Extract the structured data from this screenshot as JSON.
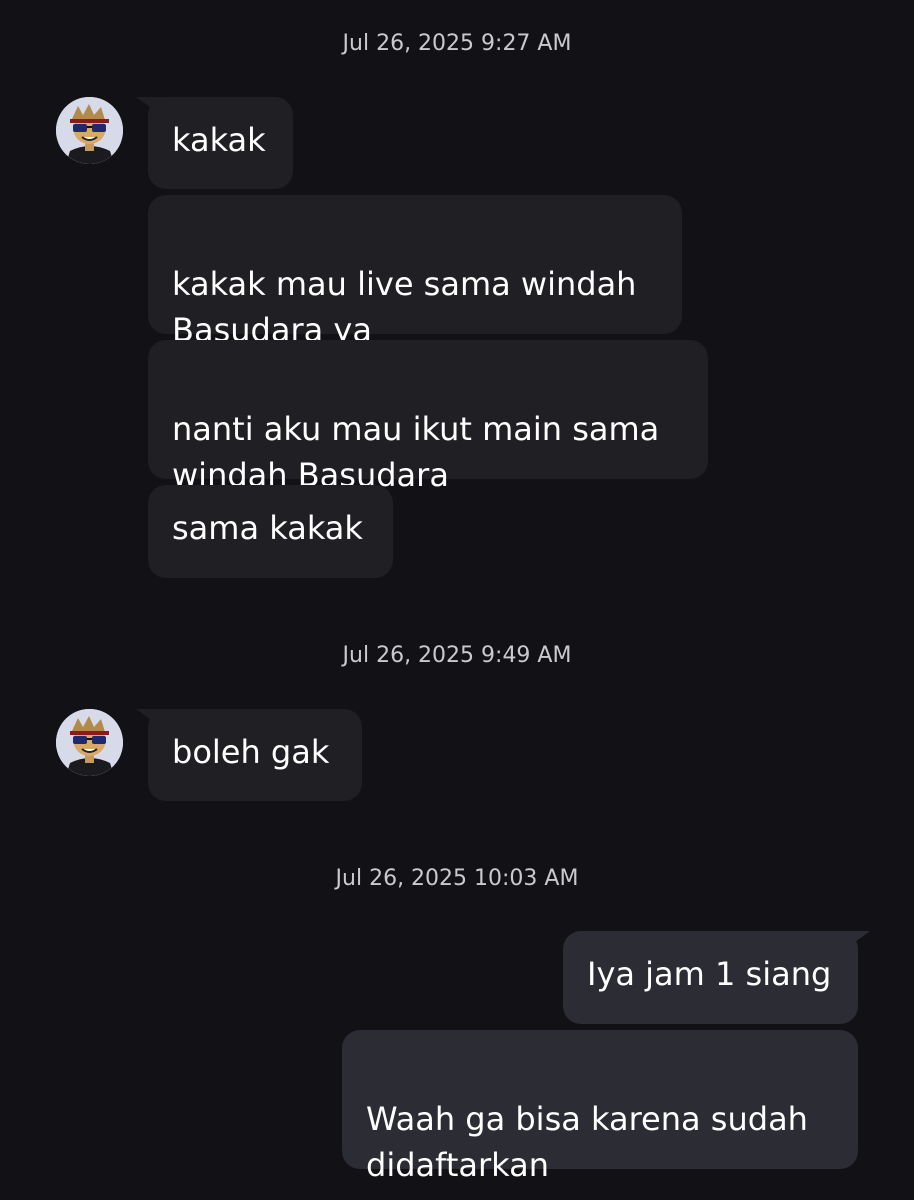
{
  "conversation": {
    "groups": [
      {
        "timestamp": "Jul 26, 2025 9:27 AM",
        "sender": "other",
        "messages": [
          "kakak",
          "kakak mau live sama windah\nBasudara ya",
          "nanti aku mau ikut main sama\nwindah Basudara",
          "sama kakak"
        ]
      },
      {
        "timestamp": "Jul 26, 2025 9:49 AM",
        "sender": "other",
        "messages": [
          "boleh gak"
        ]
      },
      {
        "timestamp": "Jul 26, 2025 10:03 AM",
        "sender": "me",
        "messages": [
          "Iya jam 1 siang",
          "Waah ga bisa karena sudah\ndidaftarkan"
        ]
      }
    ]
  },
  "avatar": {
    "icon": "roblox-avatar-icon",
    "background": "#d7dae8"
  },
  "colors": {
    "background": "#111116",
    "incoming_bubble": "#1f1f24",
    "outgoing_bubble": "#2c2c34",
    "timestamp_text": "#c9c9ce",
    "message_text": "#ffffff"
  }
}
